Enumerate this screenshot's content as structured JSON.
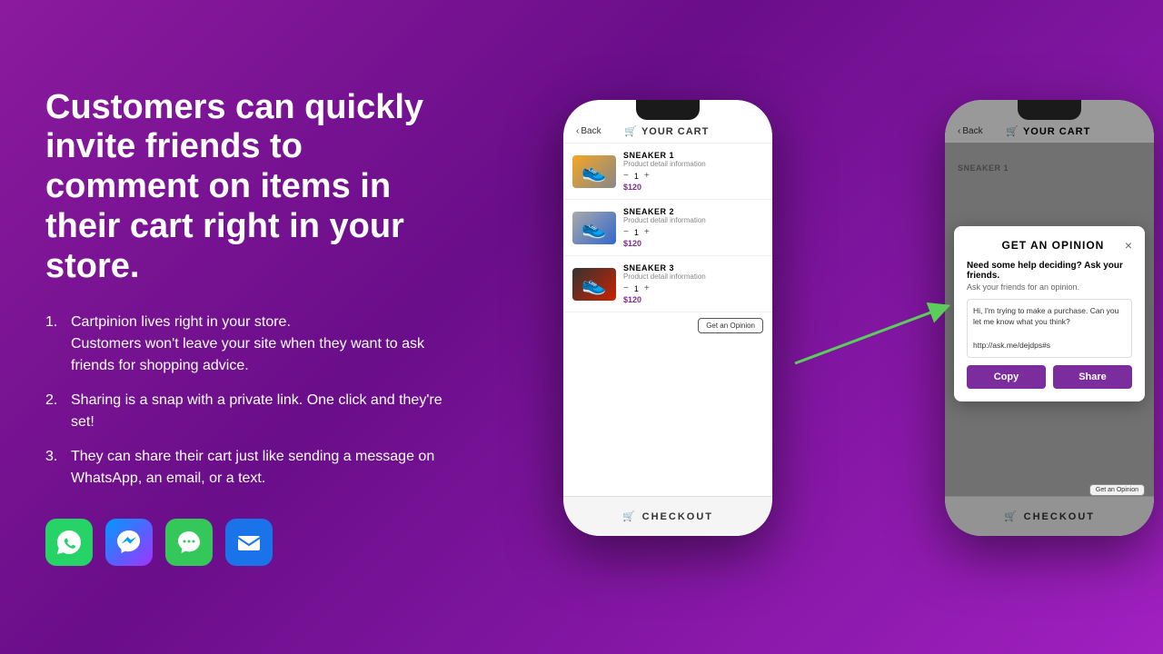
{
  "left": {
    "headline": "Customers can quickly invite friends to comment on items in their cart right in your store.",
    "features": [
      {
        "title": "Cartpinion lives right in your store.",
        "body": "Customers won't leave your site when they want to ask friends for shopping advice."
      },
      {
        "title": "Sharing is a snap with a private link. One click and they're set!",
        "body": ""
      },
      {
        "title": "They can share their cart just like sending a message on WhatsApp, an email, or a text.",
        "body": ""
      }
    ],
    "app_icons": [
      "whatsapp",
      "messenger",
      "imessage",
      "mail"
    ]
  },
  "phone1": {
    "back_label": "Back",
    "cart_title": "YOUR CART",
    "items": [
      {
        "name": "SNEAKER 1",
        "detail": "Product detail information",
        "qty": "1",
        "price": "$120",
        "shoe_class": "yellow"
      },
      {
        "name": "SNEAKER 2",
        "detail": "Product detail information",
        "qty": "1",
        "price": "$120",
        "shoe_class": "grey"
      },
      {
        "name": "SNEAKER 3",
        "detail": "Product detail information",
        "qty": "1",
        "price": "$120",
        "shoe_class": "black"
      }
    ],
    "opinion_btn": "Get an Opinion",
    "checkout_label": "CHECKOUT"
  },
  "phone2": {
    "back_label": "Back",
    "cart_title": "YOUR CART",
    "checkout_label": "CHECKOUT",
    "get_opinion_footer": "Get an Opinion",
    "modal": {
      "title": "GET AN OPINION",
      "subtitle": "Need some help deciding? Ask your friends.",
      "ask_label": "Ask your friends for an opinion.",
      "message": "Hi, I'm trying to make a purchase. Can you let me know what you think?\n\nhttp://ask.me/dejdps#s",
      "copy_btn": "Copy",
      "share_btn": "Share"
    }
  }
}
